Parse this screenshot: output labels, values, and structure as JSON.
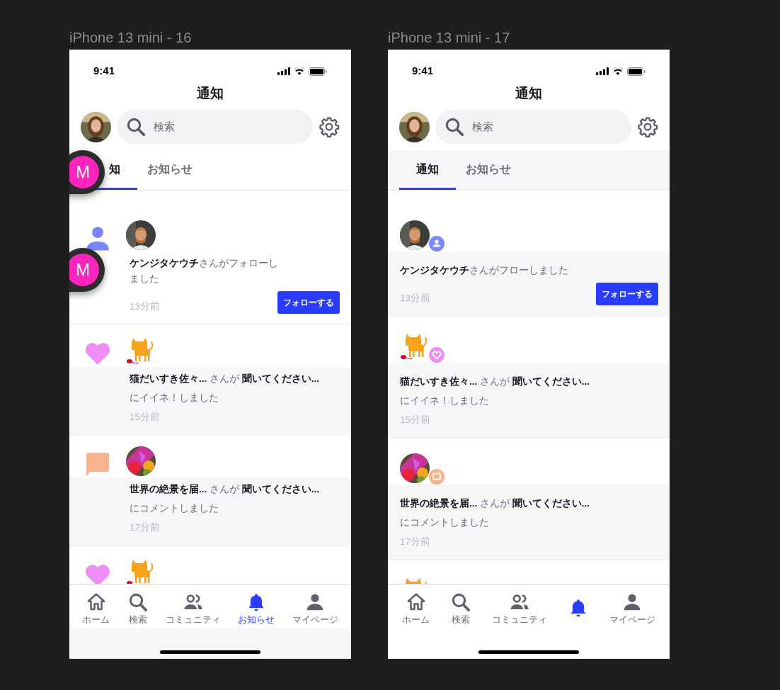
{
  "frames": [
    {
      "label": "iPhone 13 mini - 16",
      "kind": "side-icon",
      "time": "9:41",
      "title": "通知",
      "search": {
        "placeholder": "検索"
      },
      "tabs": [
        {
          "label": "知",
          "selected": true
        },
        {
          "label": "お知らせ",
          "selected": false
        }
      ],
      "notifications": [
        {
          "kind": "follow",
          "message": "**ケンジタケウチ**さんがフォローしました",
          "time": "13分前",
          "button": "フォローする"
        },
        {
          "kind": "like",
          "message": "**猫だいすき佐々...** さんが **聞いてください...**",
          "action": "にイイネ！しました",
          "time": "15分前"
        },
        {
          "kind": "comment",
          "message": "**世界の絶景を届...** さんが **聞いてください...**",
          "action": "にコメントしました",
          "time": "17分前"
        },
        {
          "kind": "like"
        }
      ],
      "nav": [
        {
          "label": "ホーム",
          "selected": false
        },
        {
          "label": "検索",
          "selected": false
        },
        {
          "label": "コミュニティ",
          "selected": false
        },
        {
          "label": "お知らせ",
          "selected": true
        },
        {
          "label": "マイページ",
          "selected": false
        }
      ],
      "comment_pins": [
        {
          "initial": "M",
          "color": "#ff24bd"
        },
        {
          "initial": "M",
          "color": "#ff24bd"
        }
      ]
    },
    {
      "label": "iPhone 13 mini - 17",
      "kind": "badge-icon",
      "time": "9:41",
      "title": "通知",
      "search": {
        "placeholder": "検索"
      },
      "tabs": [
        {
          "label": "通知",
          "selected": true
        },
        {
          "label": "お知らせ",
          "selected": false
        }
      ],
      "notifications": [
        {
          "kind": "follow",
          "message": "**ケンジタケウチ**さんがフローしました",
          "time": "13分前",
          "button": "フォローする"
        },
        {
          "kind": "like",
          "message": "**猫だいすき佐々...** さんが **聞いてください...**",
          "action": "にイイネ！しました",
          "time": "15分前"
        },
        {
          "kind": "comment",
          "message": "**世界の絶景を届...** さんが **聞いてください...**",
          "action": "にコメントしました",
          "time": "17分前"
        },
        {
          "kind": "like"
        }
      ],
      "nav": [
        {
          "label": "ホーム",
          "selected": false
        },
        {
          "label": "検索",
          "selected": false
        },
        {
          "label": "コミュニティ",
          "selected": false
        },
        {
          "selected": true
        },
        {
          "label": "マイページ",
          "selected": false
        }
      ]
    }
  ]
}
